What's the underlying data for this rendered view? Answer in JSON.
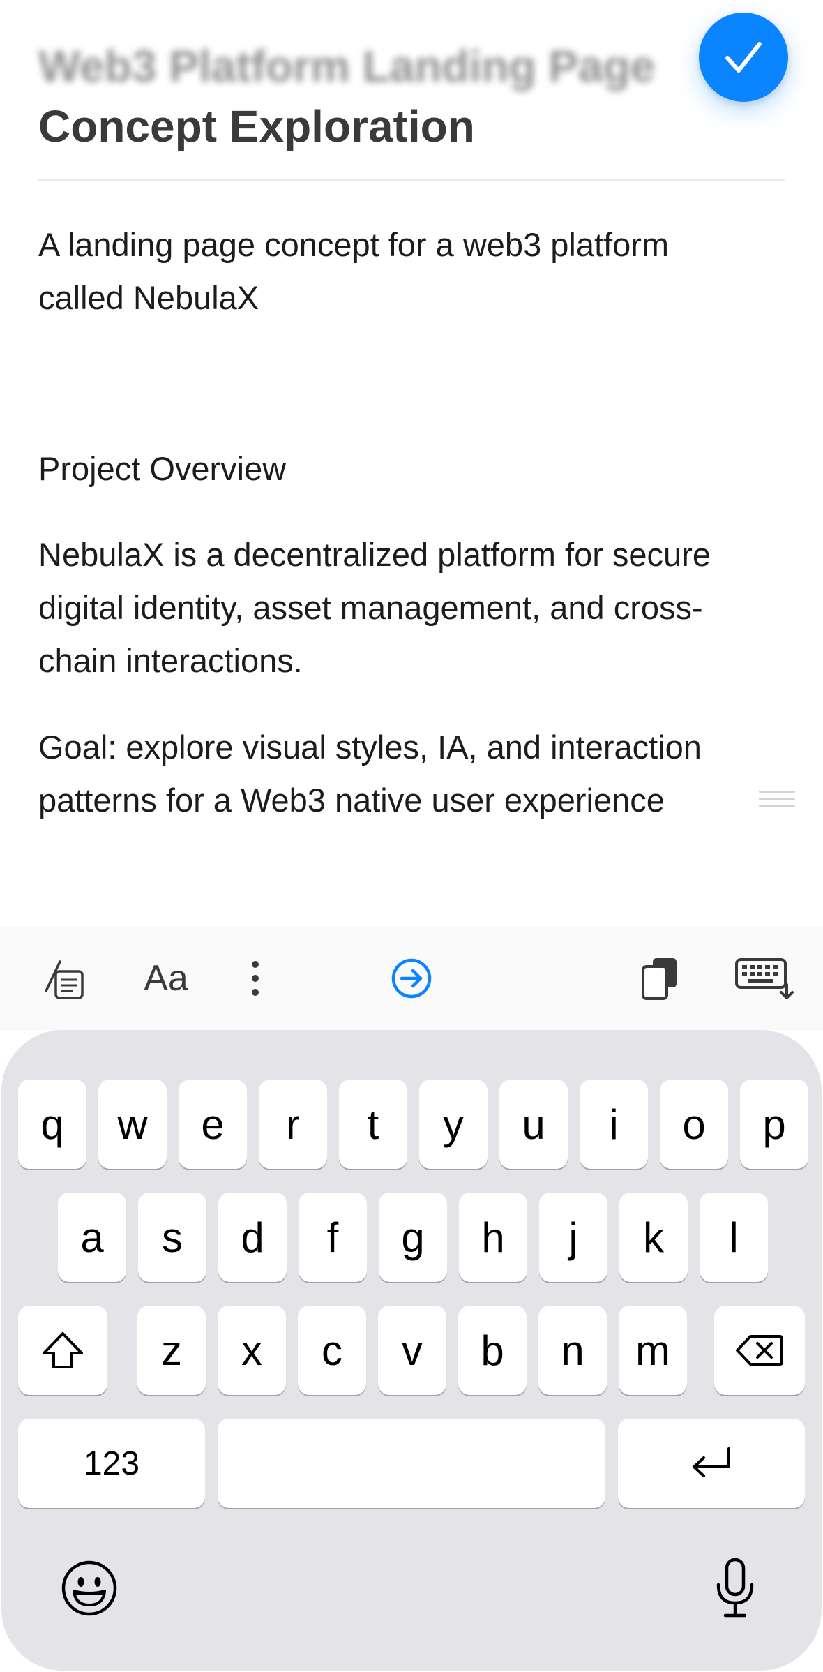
{
  "note": {
    "title_line1": "Web3 Platform Landing Page",
    "title_line2": "Concept Exploration",
    "paragraphs": [
      "A landing page concept for a web3 platform called NebulaX",
      "Project Overview",
      "NebulaX is a decentralized platform for secure digital identity, asset management, and cross-chain interactions.",
      "Goal: explore visual styles, IA, and interaction patterns for a Web3 native user experience"
    ]
  },
  "toolbar": {
    "items": [
      {
        "name": "edit-format-icon"
      },
      {
        "name": "text-style",
        "label": "Aa"
      },
      {
        "name": "more-icon"
      },
      {
        "name": "forward-icon"
      },
      {
        "name": "clipboard-icon"
      },
      {
        "name": "hide-keyboard-icon"
      }
    ]
  },
  "keyboard": {
    "row1": [
      "q",
      "w",
      "e",
      "r",
      "t",
      "y",
      "u",
      "i",
      "o",
      "p"
    ],
    "row2": [
      "a",
      "s",
      "d",
      "f",
      "g",
      "h",
      "j",
      "k",
      "l"
    ],
    "row3": [
      "z",
      "x",
      "c",
      "v",
      "b",
      "n",
      "m"
    ],
    "numbers_label": "123",
    "icons": [
      "shift-icon",
      "delete-icon",
      "return-icon",
      "emoji-icon",
      "microphone-icon"
    ]
  },
  "colors": {
    "accent": "#0a84ff",
    "keyboard_bg": "#e3e3e8",
    "key_bg": "#ffffff"
  }
}
